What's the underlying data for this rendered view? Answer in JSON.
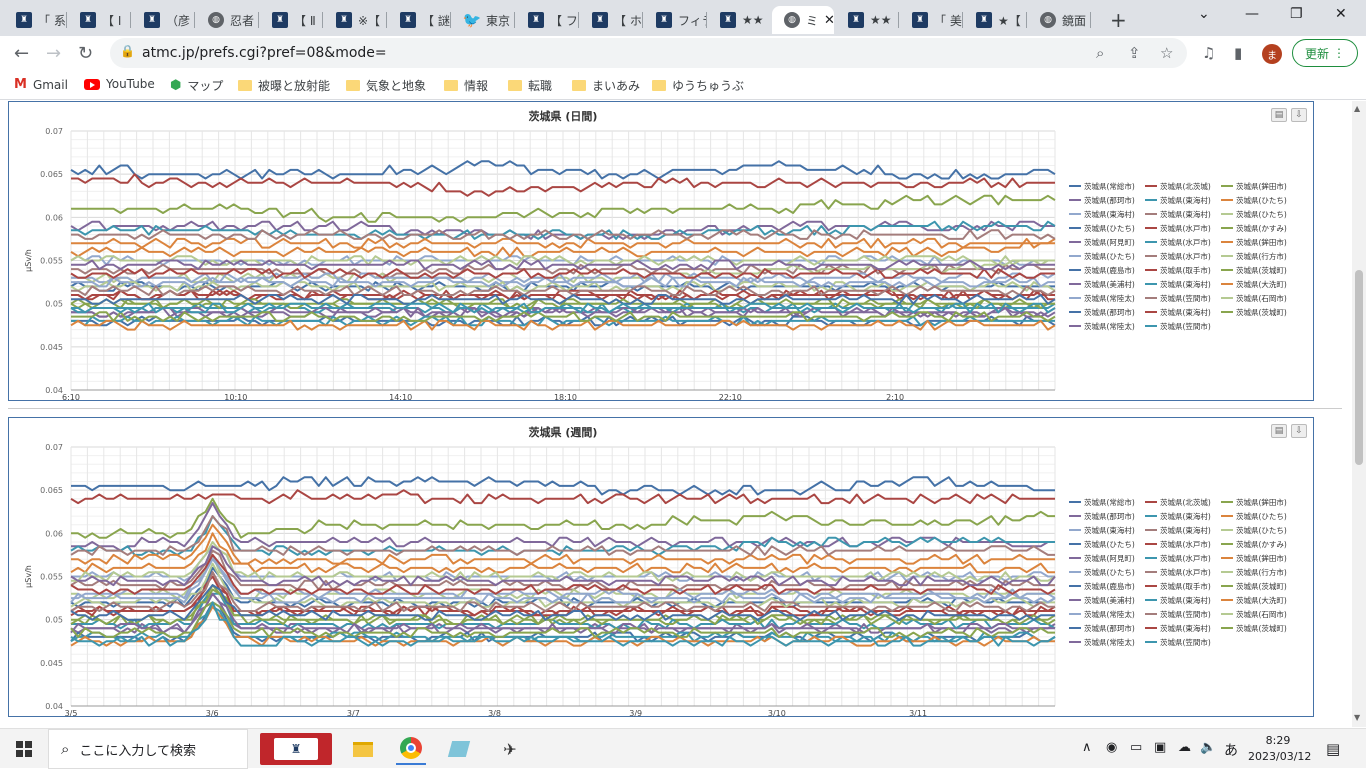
{
  "tabs": [
    {
      "title": "「 系",
      "icon": "site"
    },
    {
      "title": "【 Ⅰ",
      "icon": "site"
    },
    {
      "title": "（彦",
      "icon": "site"
    },
    {
      "title": "忍者",
      "icon": "globe"
    },
    {
      "title": "【 Ⅱ",
      "icon": "site"
    },
    {
      "title": "※【",
      "icon": "site"
    },
    {
      "title": "【 謎",
      "icon": "site"
    },
    {
      "title": "東京",
      "icon": "twitter"
    },
    {
      "title": "【 フ",
      "icon": "site"
    },
    {
      "title": "【 ホ",
      "icon": "site"
    },
    {
      "title": "フィラ",
      "icon": "site"
    },
    {
      "title": "★★",
      "icon": "site"
    },
    {
      "title": "ミ",
      "icon": "globe",
      "active": true
    },
    {
      "title": "★★",
      "icon": "site"
    },
    {
      "title": "「 美",
      "icon": "site"
    },
    {
      "title": "★【",
      "icon": "site"
    },
    {
      "title": "鏡面",
      "icon": "globe"
    }
  ],
  "toolbar": {
    "url": "atmc.jp/prefs.cgi?pref=08&mode=",
    "update_label": "更新",
    "avatar_letter": "ま"
  },
  "bookmarks": [
    {
      "label": "Gmail",
      "icon": "gmail-icon"
    },
    {
      "label": "YouTube",
      "icon": "youtube-icon"
    },
    {
      "label": "マップ",
      "icon": "maps-icon"
    },
    {
      "label": "被曝と放射能",
      "icon": "folder-icon"
    },
    {
      "label": "気象と地象",
      "icon": "folder-icon"
    },
    {
      "label": "情報",
      "icon": "folder-icon"
    },
    {
      "label": "転職",
      "icon": "folder-icon"
    },
    {
      "label": "まいあみ",
      "icon": "folder-icon"
    },
    {
      "label": "ゆうちゅうぶ",
      "icon": "folder-icon"
    }
  ],
  "legend_palette": [
    "#4572a7",
    "#aa4643",
    "#89a54e",
    "#80699b",
    "#3d96ae",
    "#db843d",
    "#92a8cd",
    "#a47d7c",
    "#b5ca92"
  ],
  "chart_data": [
    {
      "type": "line",
      "title": "茨城県 (日間)",
      "ylabel": "μSv/h",
      "ylim": [
        0.04,
        0.07
      ],
      "yticks": [
        "0.07",
        "0.065",
        "0.06",
        "0.055",
        "0.05",
        "0.045",
        "0.04"
      ],
      "xticks": [
        "6:10",
        "10:10",
        "14:10",
        "18:10",
        "22:10",
        "2:10"
      ],
      "n_points": 140,
      "series": [
        {
          "name": "茨城県(常総市)",
          "values": [
            0.0655,
            0.065,
            0.065,
            0.066,
            0.065,
            0.066,
            0.065,
            0.065
          ]
        },
        {
          "name": "茨城県(北茨城)",
          "values": [
            0.0645,
            0.064,
            0.064,
            0.063,
            0.064,
            0.064,
            0.064,
            0.064
          ]
        },
        {
          "name": "茨城県(鉾田市)",
          "values": [
            0.061,
            0.061,
            0.06,
            0.06,
            0.061,
            0.061,
            0.062,
            0.062
          ]
        },
        {
          "name": "茨城県(那珂市)",
          "values": [
            0.059,
            0.059,
            0.059,
            0.058,
            0.058,
            0.059,
            0.059,
            0.059
          ]
        },
        {
          "name": "茨城県(東海村)",
          "values": [
            0.0585,
            0.0585,
            0.058,
            0.058,
            0.058,
            0.0585,
            0.059,
            0.059
          ]
        },
        {
          "name": "茨城県(ひたち)",
          "values": [
            0.057,
            0.057,
            0.057,
            0.057,
            0.057,
            0.057,
            0.057,
            0.057
          ]
        },
        {
          "name": "茨城県(東海村)",
          "values": [
            0.055,
            0.055,
            0.055,
            0.055,
            0.055,
            0.055,
            0.055,
            0.055
          ]
        },
        {
          "name": "茨城県(東海村)",
          "values": [
            0.054,
            0.054,
            0.0535,
            0.054,
            0.054,
            0.054,
            0.054,
            0.054
          ]
        },
        {
          "name": "茨城県(ひたち)",
          "values": [
            0.053,
            0.053,
            0.053,
            0.053,
            0.053,
            0.054,
            0.054,
            0.055
          ]
        },
        {
          "name": "茨城県(ひたち)",
          "values": [
            0.052,
            0.052,
            0.052,
            0.052,
            0.052,
            0.052,
            0.052,
            0.052
          ]
        },
        {
          "name": "茨城県(水戸市)",
          "values": [
            0.051,
            0.051,
            0.051,
            0.051,
            0.051,
            0.051,
            0.051,
            0.051
          ]
        },
        {
          "name": "茨城県(かすみ)",
          "values": [
            0.05,
            0.05,
            0.05,
            0.05,
            0.05,
            0.05,
            0.05,
            0.05
          ]
        },
        {
          "name": "茨城県(阿見町)",
          "values": [
            0.049,
            0.049,
            0.049,
            0.049,
            0.049,
            0.049,
            0.049,
            0.049
          ]
        },
        {
          "name": "茨城県(水戸市)",
          "values": [
            0.0495,
            0.0495,
            0.0495,
            0.0495,
            0.0495,
            0.0495,
            0.0495,
            0.0495
          ]
        },
        {
          "name": "茨城県(鉾田市)",
          "values": [
            0.056,
            0.056,
            0.056,
            0.056,
            0.056,
            0.056,
            0.056,
            0.057
          ]
        },
        {
          "name": "茨城県(ひたち)",
          "values": [
            0.053,
            0.053,
            0.053,
            0.053,
            0.053,
            0.053,
            0.053,
            0.053
          ]
        },
        {
          "name": "茨城県(水戸市)",
          "values": [
            0.058,
            0.058,
            0.058,
            0.058,
            0.058,
            0.058,
            0.058,
            0.058
          ]
        },
        {
          "name": "茨城県(行方市)",
          "values": [
            0.052,
            0.052,
            0.052,
            0.052,
            0.052,
            0.052,
            0.052,
            0.052
          ]
        },
        {
          "name": "茨城県(鹿島市)",
          "values": [
            0.048,
            0.048,
            0.048,
            0.048,
            0.048,
            0.048,
            0.048,
            0.048
          ]
        },
        {
          "name": "茨城県(取手市)",
          "values": [
            0.051,
            0.051,
            0.051,
            0.051,
            0.051,
            0.051,
            0.051,
            0.051
          ]
        },
        {
          "name": "茨城県(茨城町)",
          "values": [
            0.05,
            0.05,
            0.05,
            0.05,
            0.05,
            0.05,
            0.05,
            0.05
          ]
        },
        {
          "name": "茨城県(美浦村)",
          "values": [
            0.049,
            0.049,
            0.049,
            0.049,
            0.049,
            0.049,
            0.049,
            0.049
          ]
        },
        {
          "name": "茨城県(東海村)",
          "values": [
            0.048,
            0.048,
            0.048,
            0.048,
            0.048,
            0.048,
            0.048,
            0.048
          ]
        },
        {
          "name": "茨城県(大洗町)",
          "values": [
            0.0475,
            0.0475,
            0.0475,
            0.0475,
            0.0475,
            0.0475,
            0.0475,
            0.0475
          ]
        },
        {
          "name": "茨城県(常陸太)",
          "values": [
            0.0525,
            0.0525,
            0.0525,
            0.0525,
            0.0525,
            0.0525,
            0.0525,
            0.0525
          ]
        },
        {
          "name": "茨城県(笠間市)",
          "values": [
            0.0515,
            0.0515,
            0.0515,
            0.0515,
            0.0515,
            0.0515,
            0.0515,
            0.0515
          ]
        },
        {
          "name": "茨城県(石岡市)",
          "values": [
            0.055,
            0.055,
            0.055,
            0.055,
            0.055,
            0.055,
            0.055,
            0.055
          ]
        },
        {
          "name": "茨城県(那珂市)",
          "values": [
            0.0505,
            0.0505,
            0.0505,
            0.0505,
            0.0505,
            0.0505,
            0.0505,
            0.0505
          ]
        },
        {
          "name": "茨城県(東海村)",
          "values": [
            0.0535,
            0.0535,
            0.0535,
            0.0535,
            0.0535,
            0.0535,
            0.0535,
            0.0535
          ]
        },
        {
          "name": "茨城県(茨城町)",
          "values": [
            0.0485,
            0.0485,
            0.0485,
            0.0485,
            0.0485,
            0.0485,
            0.0485,
            0.0485
          ]
        },
        {
          "name": "茨城県(常陸太)",
          "values": [
            0.0545,
            0.0545,
            0.0545,
            0.0545,
            0.0545,
            0.0545,
            0.0545,
            0.0545
          ]
        },
        {
          "name": "茨城県(笠間市)",
          "values": [
            0.0495,
            0.0495,
            0.0495,
            0.0495,
            0.0495,
            0.0495,
            0.0495,
            0.0495
          ]
        }
      ]
    },
    {
      "type": "line",
      "title": "茨城県 (週間)",
      "ylabel": "μSv/h",
      "ylim": [
        0.04,
        0.07
      ],
      "yticks": [
        "0.07",
        "0.065",
        "0.06",
        "0.055",
        "0.05",
        "0.045",
        "0.04"
      ],
      "xticks": [
        "3/5",
        "3/6",
        "3/7",
        "3/8",
        "3/9",
        "3/10",
        "3/11"
      ],
      "n_points": 140,
      "spike_at": 0.145,
      "series": [
        {
          "name": "茨城県(常総市)",
          "values": [
            0.0655,
            0.0655,
            0.066,
            0.066,
            0.065,
            0.065,
            0.066,
            0.065
          ]
        },
        {
          "name": "茨城県(北茨城)",
          "values": [
            0.064,
            0.064,
            0.0645,
            0.064,
            0.064,
            0.064,
            0.064,
            0.064
          ]
        },
        {
          "name": "茨城県(鉾田市)",
          "values": [
            0.06,
            0.06,
            0.061,
            0.061,
            0.061,
            0.062,
            0.061,
            0.062
          ]
        },
        {
          "name": "茨城県(那珂市)",
          "values": [
            0.0585,
            0.059,
            0.059,
            0.059,
            0.059,
            0.059,
            0.059,
            0.059
          ]
        },
        {
          "name": "茨城県(東海村)",
          "values": [
            0.058,
            0.058,
            0.058,
            0.058,
            0.058,
            0.059,
            0.059,
            0.059
          ]
        },
        {
          "name": "茨城県(ひたち)",
          "values": [
            0.057,
            0.057,
            0.057,
            0.057,
            0.057,
            0.057,
            0.057,
            0.057
          ]
        },
        {
          "name": "茨城県(東海村)",
          "values": [
            0.055,
            0.055,
            0.055,
            0.055,
            0.055,
            0.055,
            0.055,
            0.055
          ]
        },
        {
          "name": "茨城県(東海村)",
          "values": [
            0.054,
            0.054,
            0.054,
            0.054,
            0.054,
            0.054,
            0.054,
            0.054
          ]
        },
        {
          "name": "茨城県(ひたち)",
          "values": [
            0.053,
            0.053,
            0.053,
            0.053,
            0.053,
            0.053,
            0.053,
            0.053
          ]
        },
        {
          "name": "茨城県(ひたち)",
          "values": [
            0.052,
            0.052,
            0.052,
            0.052,
            0.052,
            0.052,
            0.052,
            0.052
          ]
        },
        {
          "name": "茨城県(水戸市)",
          "values": [
            0.051,
            0.051,
            0.051,
            0.051,
            0.051,
            0.051,
            0.051,
            0.051
          ]
        },
        {
          "name": "茨城県(かすみ)",
          "values": [
            0.05,
            0.05,
            0.05,
            0.05,
            0.05,
            0.05,
            0.05,
            0.05
          ]
        },
        {
          "name": "茨城県(阿見町)",
          "values": [
            0.049,
            0.049,
            0.049,
            0.049,
            0.049,
            0.049,
            0.049,
            0.049
          ]
        },
        {
          "name": "茨城県(水戸市)",
          "values": [
            0.0495,
            0.0495,
            0.0495,
            0.0495,
            0.0495,
            0.0495,
            0.0495,
            0.0495
          ]
        },
        {
          "name": "茨城県(鉾田市)",
          "values": [
            0.056,
            0.056,
            0.056,
            0.056,
            0.056,
            0.056,
            0.056,
            0.056
          ]
        },
        {
          "name": "茨城県(ひたち)",
          "values": [
            0.053,
            0.053,
            0.053,
            0.053,
            0.053,
            0.053,
            0.053,
            0.053
          ]
        },
        {
          "name": "茨城県(水戸市)",
          "values": [
            0.058,
            0.058,
            0.058,
            0.058,
            0.058,
            0.058,
            0.058,
            0.058
          ]
        },
        {
          "name": "茨城県(行方市)",
          "values": [
            0.052,
            0.052,
            0.052,
            0.052,
            0.052,
            0.052,
            0.052,
            0.052
          ]
        },
        {
          "name": "茨城県(鹿島市)",
          "values": [
            0.048,
            0.048,
            0.048,
            0.048,
            0.048,
            0.048,
            0.048,
            0.048
          ]
        },
        {
          "name": "茨城県(取手市)",
          "values": [
            0.051,
            0.051,
            0.051,
            0.051,
            0.051,
            0.051,
            0.051,
            0.051
          ]
        },
        {
          "name": "茨城県(茨城町)",
          "values": [
            0.05,
            0.05,
            0.05,
            0.05,
            0.05,
            0.05,
            0.05,
            0.05
          ]
        },
        {
          "name": "茨城県(美浦村)",
          "values": [
            0.049,
            0.049,
            0.049,
            0.049,
            0.049,
            0.049,
            0.049,
            0.049
          ]
        },
        {
          "name": "茨城県(東海村)",
          "values": [
            0.048,
            0.048,
            0.048,
            0.048,
            0.048,
            0.048,
            0.048,
            0.048
          ]
        },
        {
          "name": "茨城県(大洗町)",
          "values": [
            0.0475,
            0.0475,
            0.0475,
            0.0475,
            0.0475,
            0.0475,
            0.0475,
            0.0475
          ]
        },
        {
          "name": "茨城県(常陸太)",
          "values": [
            0.0525,
            0.0525,
            0.0525,
            0.0525,
            0.0525,
            0.0525,
            0.0525,
            0.0525
          ]
        },
        {
          "name": "茨城県(笠間市)",
          "values": [
            0.0515,
            0.0515,
            0.0515,
            0.0515,
            0.0515,
            0.0515,
            0.0515,
            0.0515
          ]
        },
        {
          "name": "茨城県(石岡市)",
          "values": [
            0.055,
            0.055,
            0.055,
            0.055,
            0.055,
            0.055,
            0.055,
            0.055
          ]
        },
        {
          "name": "茨城県(那珂市)",
          "values": [
            0.0505,
            0.0505,
            0.0505,
            0.0505,
            0.0505,
            0.0505,
            0.0505,
            0.0505
          ]
        },
        {
          "name": "茨城県(東海村)",
          "values": [
            0.0535,
            0.0535,
            0.0535,
            0.0535,
            0.0535,
            0.0535,
            0.0535,
            0.0535
          ]
        },
        {
          "name": "茨城県(茨城町)",
          "values": [
            0.0485,
            0.0485,
            0.0485,
            0.0485,
            0.0485,
            0.0485,
            0.0485,
            0.0485
          ]
        },
        {
          "name": "茨城県(常陸太)",
          "values": [
            0.0545,
            0.0545,
            0.0545,
            0.0545,
            0.0545,
            0.0545,
            0.0545,
            0.0545
          ]
        },
        {
          "name": "茨城県(笠間市)",
          "values": [
            0.0475,
            0.0475,
            0.0475,
            0.0475,
            0.0475,
            0.0475,
            0.0475,
            0.0475
          ]
        }
      ]
    }
  ],
  "taskbar": {
    "search_placeholder": "ここに入力して検索",
    "ime": "あ",
    "time": "8:29",
    "date": "2023/03/12"
  }
}
